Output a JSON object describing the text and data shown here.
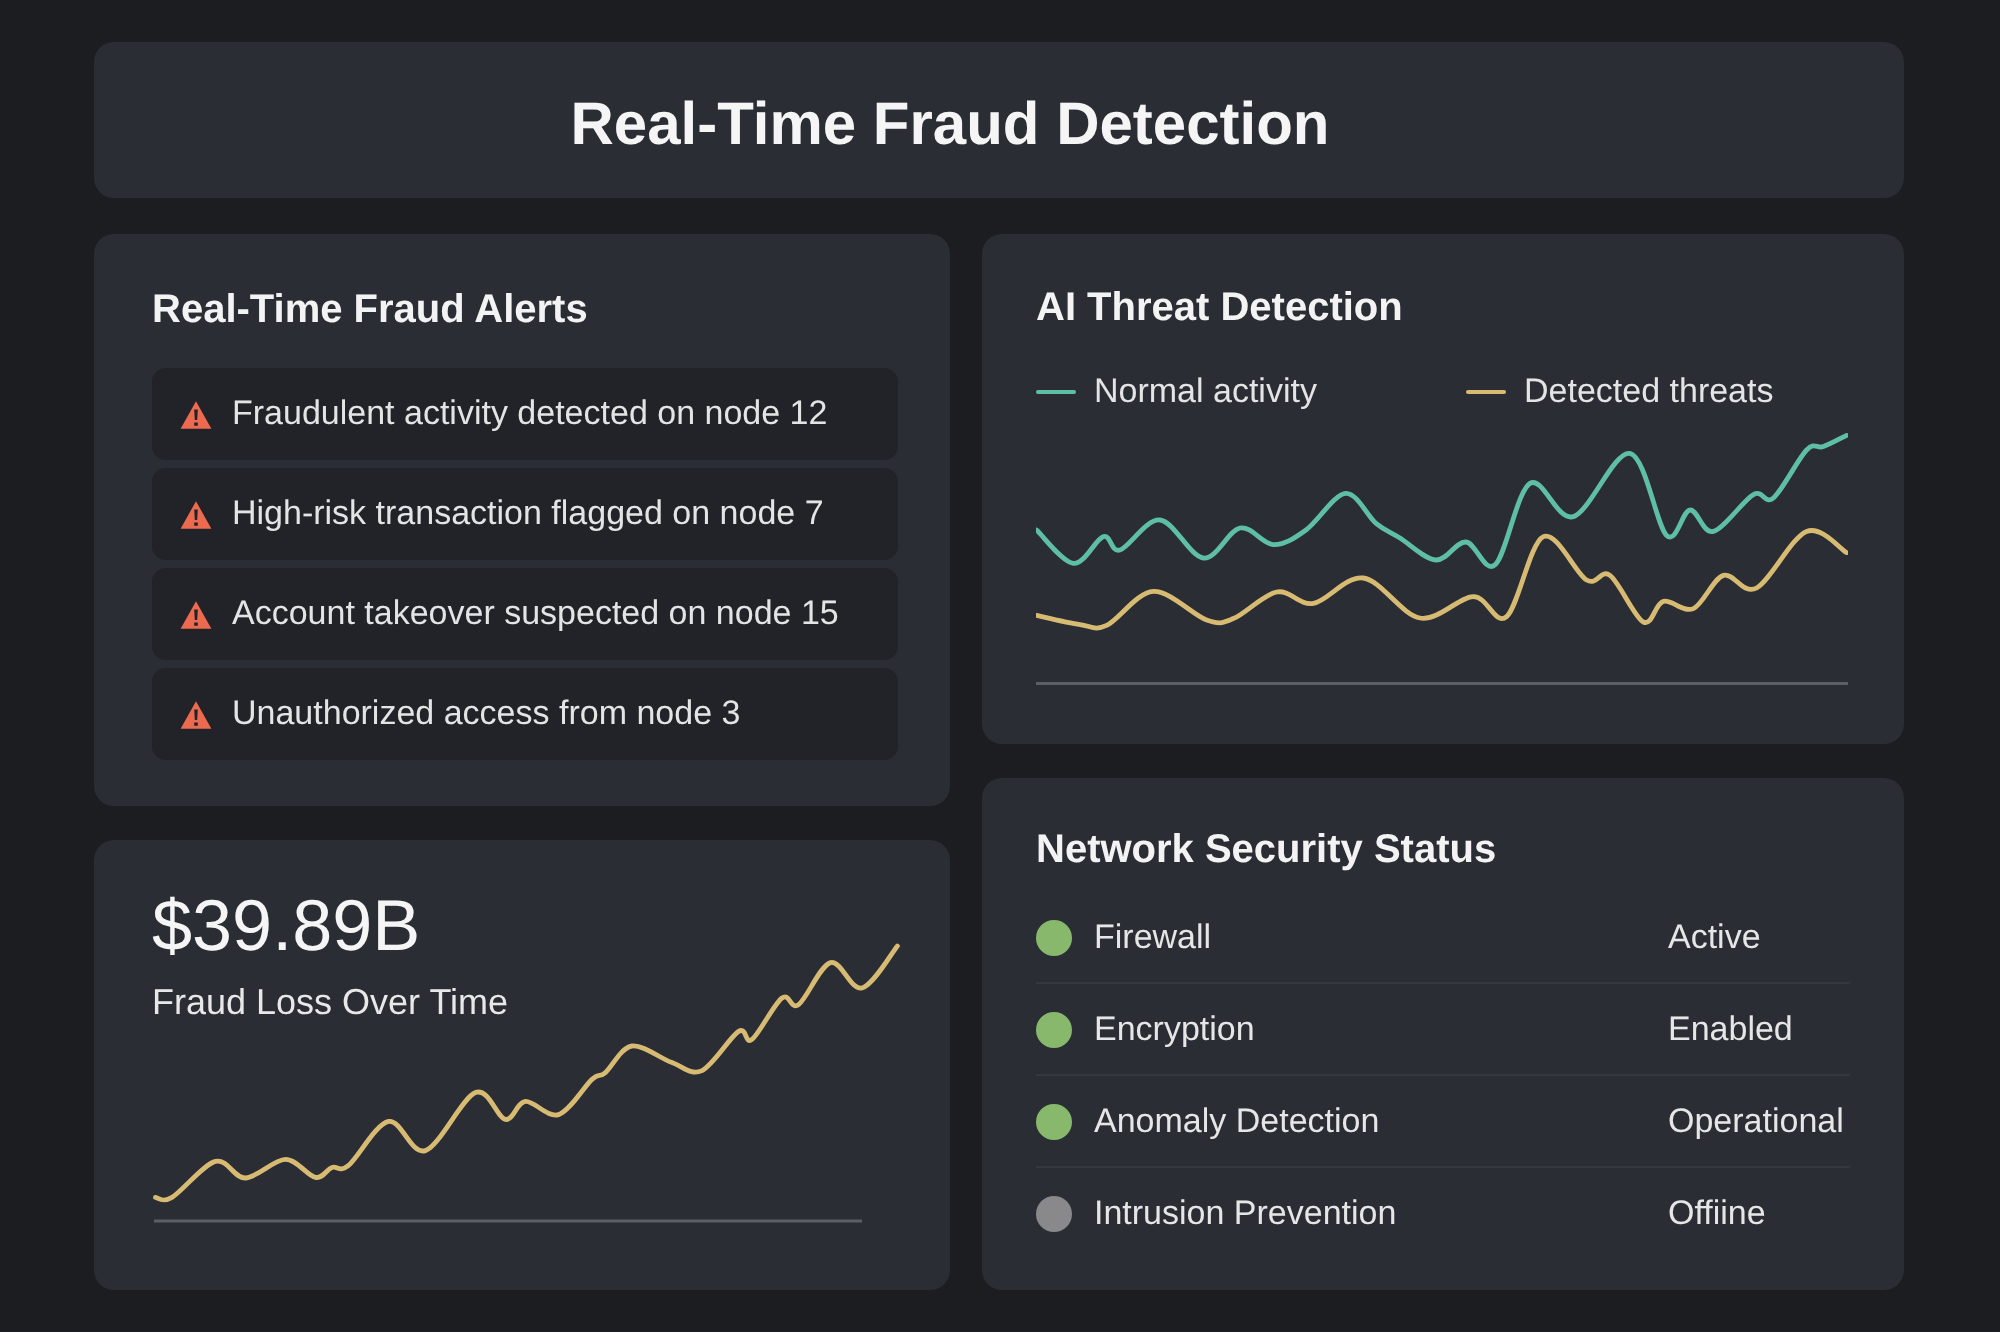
{
  "header": {
    "title": "Real-Time Fraud Detection"
  },
  "fraud_alerts": {
    "title": "Real-Time Fraud Alerts",
    "alerts": [
      {
        "text": "Fraudulent activity detected on node 12"
      },
      {
        "text": "High-risk transaction flagged on node 7"
      },
      {
        "text": "Account takeover suspected on node 15"
      },
      {
        "text": "Unauthorized access from node 3"
      }
    ]
  },
  "fraud_loss": {
    "amount": "$39.89B",
    "label": "Fraud Loss Over Time"
  },
  "threat_detection": {
    "title": "AI Threat Detection",
    "legend": [
      {
        "label": "Normal activity",
        "color": "#5fbfa6"
      },
      {
        "label": "Detected threats",
        "color": "#d8bb72"
      }
    ]
  },
  "network_status": {
    "title": "Network Security Status",
    "items": [
      {
        "name": "Firewall",
        "status": "Active",
        "color": "#88b86c"
      },
      {
        "name": "Encryption",
        "status": "Enabled",
        "color": "#88b86c"
      },
      {
        "name": "Anomaly Detection",
        "status": "Operational",
        "color": "#88b86c"
      },
      {
        "name": "Intrusion Prevention",
        "status": "Offiine",
        "color": "#89898c"
      }
    ]
  }
}
